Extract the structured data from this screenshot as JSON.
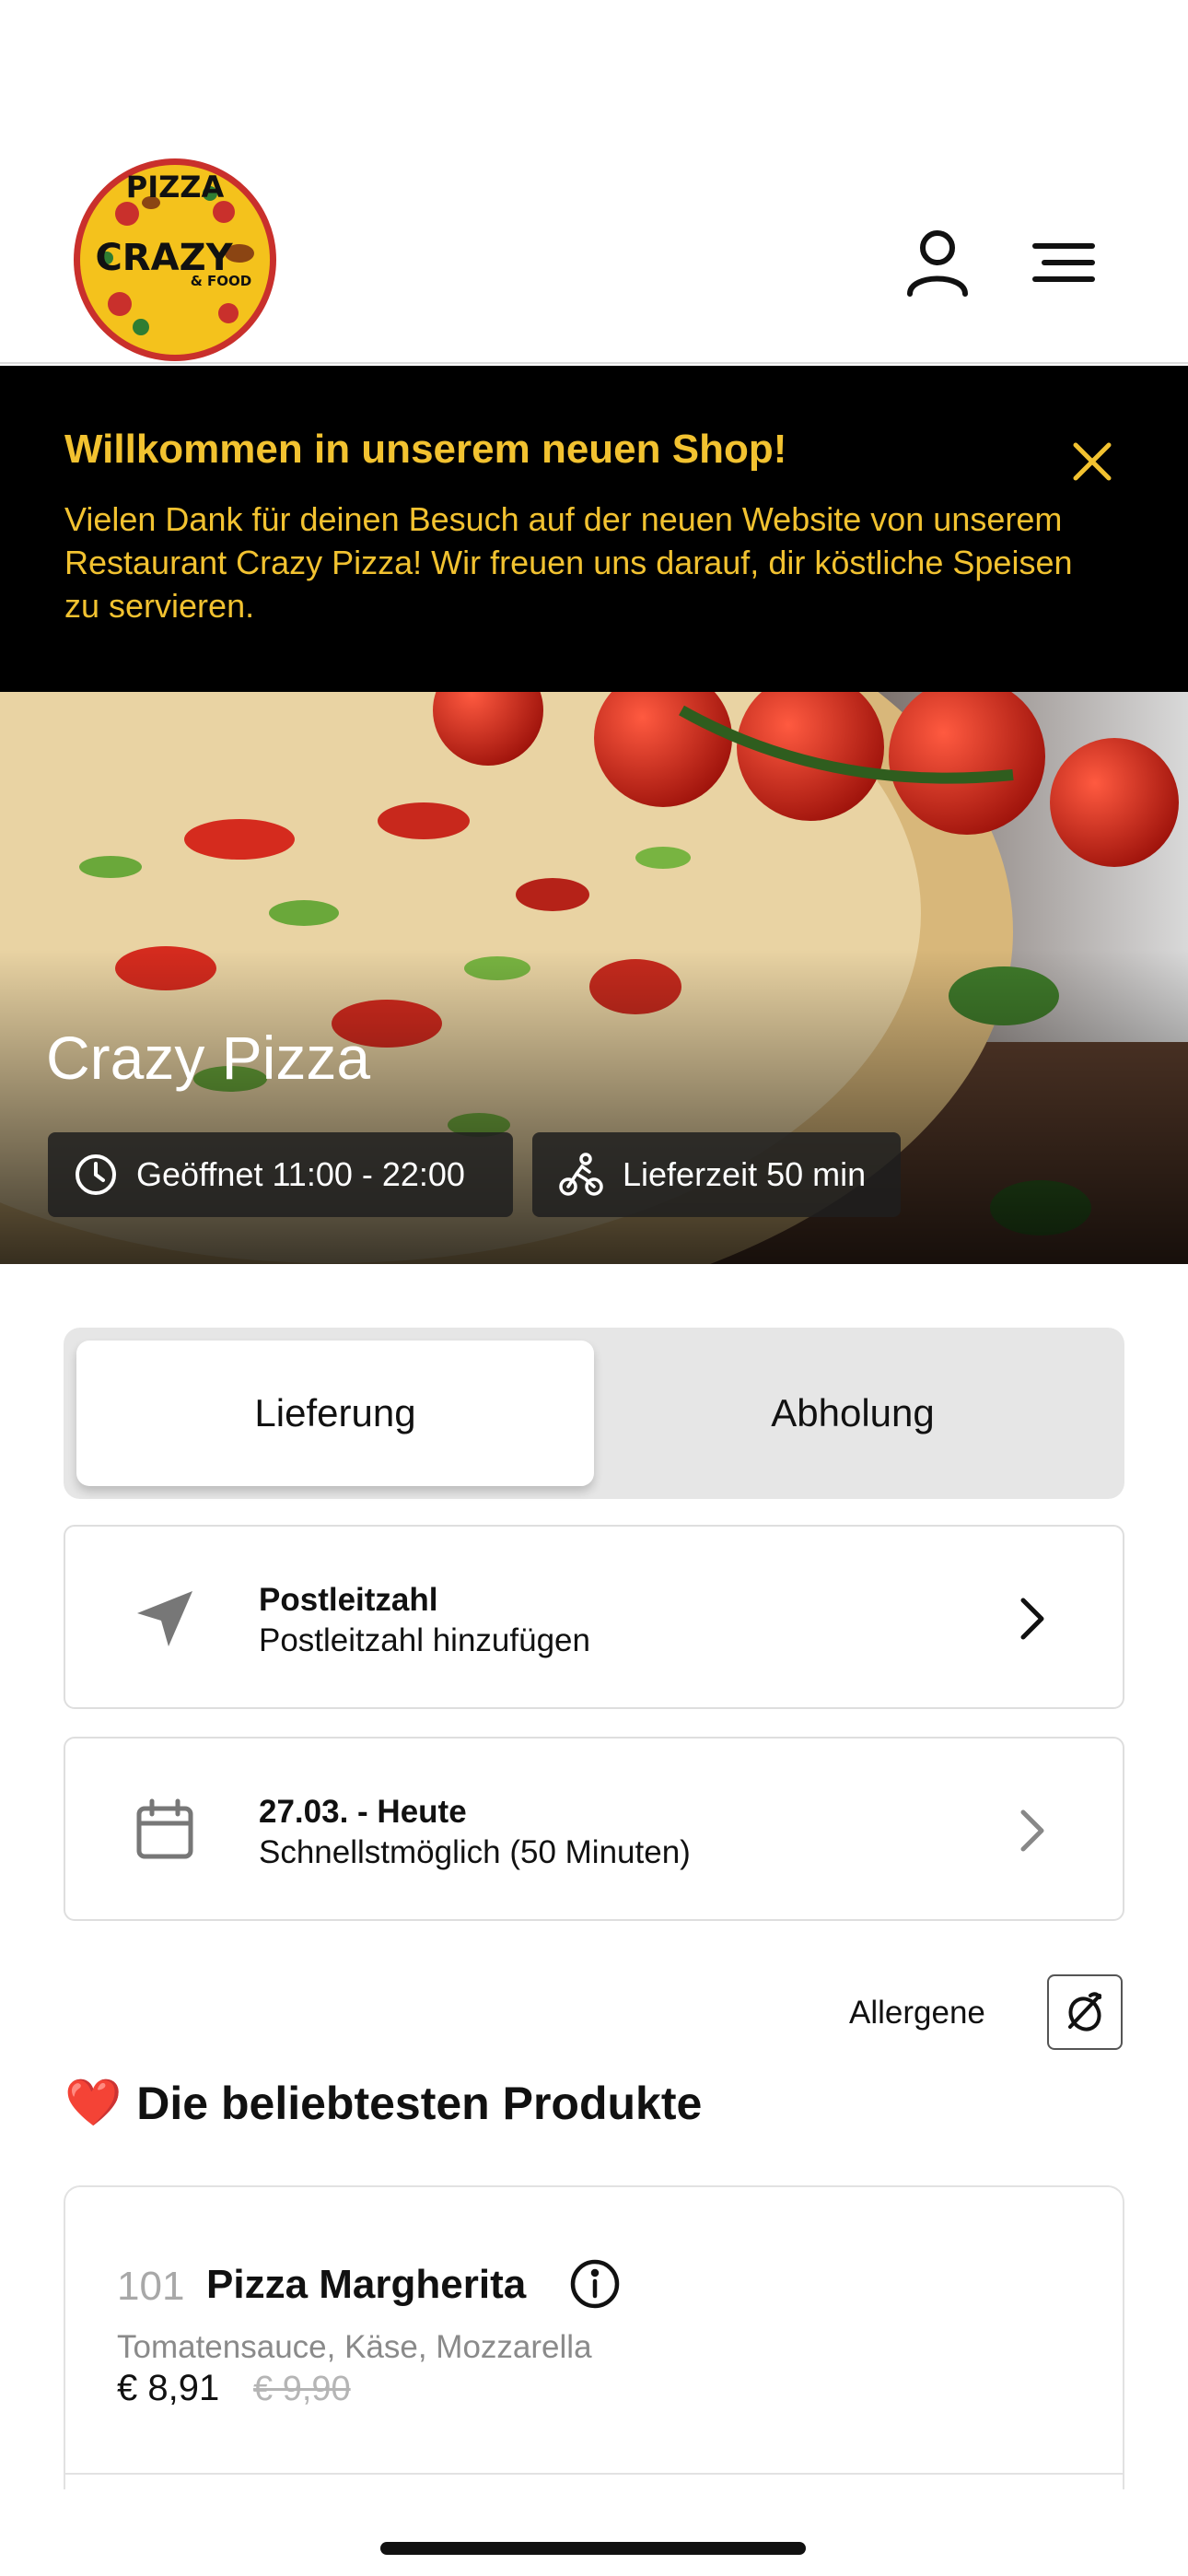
{
  "header": {
    "logo_text": {
      "line1": "PIZZA",
      "line2": "CRAZY",
      "line3": "& FOOD"
    },
    "user_icon": "user-icon",
    "menu_icon": "hamburger-menu-icon"
  },
  "banner": {
    "title": "Willkommen in unserem neuen Shop!",
    "text": "Vielen Dank für deinen Besuch auf der neuen Website von unserem Restaurant Crazy Pizza! Wir freuen uns darauf, dir köstliche Speisen zu servieren.",
    "close_icon": "close-icon",
    "accent_color": "#f2c230"
  },
  "hero": {
    "restaurant_name": "Crazy Pizza",
    "opening_hours": "Geöffnet 11:00 - 22:00",
    "delivery_time": "Lieferzeit 50 min"
  },
  "mode_toggle": {
    "options": [
      "Lieferung",
      "Abholung"
    ],
    "selected": "Lieferung"
  },
  "postal_card": {
    "title": "Postleitzahl",
    "subtitle": "Postleitzahl hinzufügen"
  },
  "date_card": {
    "title": "27.03. - Heute",
    "subtitle": "Schnellstmöglich (50 Minuten)"
  },
  "allergens": {
    "label": "Allergene",
    "icon": "allergen-filter-icon"
  },
  "popular": {
    "emoji": "❤️",
    "title": "Die beliebtesten Produkte",
    "products": [
      {
        "number": "101",
        "name": "Pizza Margherita",
        "description": "Tomatensauce, Käse, Mozzarella",
        "price": "€ 8,91",
        "old_price": "€ 9,90"
      }
    ]
  }
}
